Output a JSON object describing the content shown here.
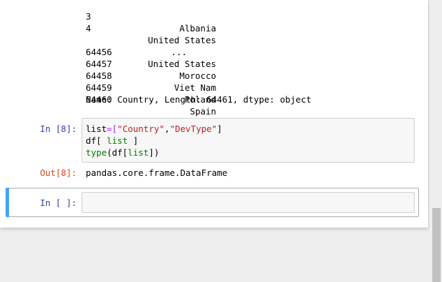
{
  "output_prev": {
    "rows": [
      {
        "index": "3",
        "value": "Albania"
      },
      {
        "index": "4",
        "value": "United States"
      },
      {
        "index": "",
        "value": "..."
      },
      {
        "index": "64456",
        "value": "United States"
      },
      {
        "index": "64457",
        "value": "Morocco"
      },
      {
        "index": "64458",
        "value": "Viet Nam"
      },
      {
        "index": "64459",
        "value": "Poland"
      },
      {
        "index": "64460",
        "value": "Spain"
      }
    ],
    "footer": "Name: Country, Length: 64461, dtype: object"
  },
  "cell8": {
    "in_prompt": "In [8]:",
    "out_prompt": "Out[8]:",
    "code": {
      "line1": {
        "a": "list",
        "b": "=[",
        "c": "\"Country\"",
        "d": ",",
        "e": "\"DevType\"",
        "f": "]"
      },
      "line2": {
        "a": "df[ ",
        "b": "list",
        "c": " ]"
      },
      "line3": {
        "a": "type",
        "b": "(df[",
        "c": "list",
        "d": "])"
      }
    },
    "output": "pandas.core.frame.DataFrame"
  },
  "cell_empty": {
    "in_prompt": "In [ ]:",
    "content": ""
  }
}
